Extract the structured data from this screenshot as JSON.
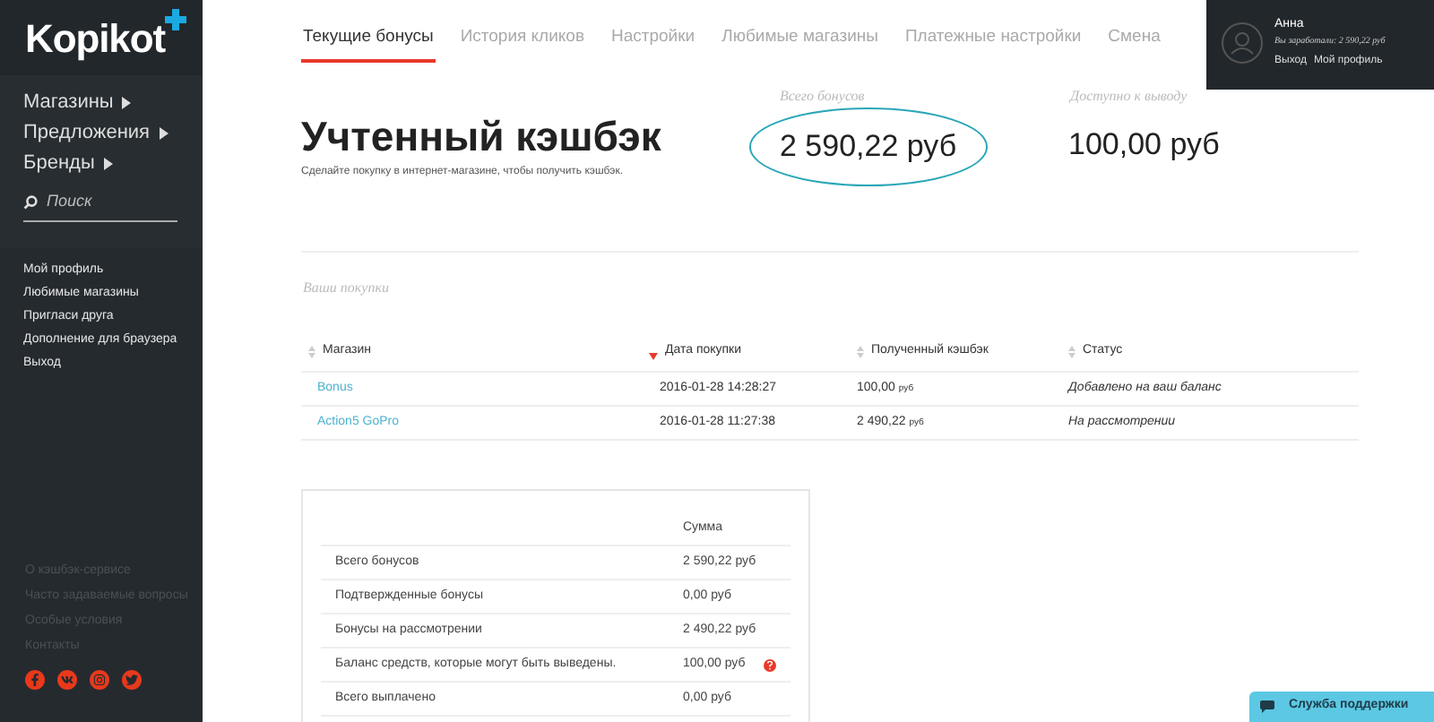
{
  "sidebar": {
    "logo": "Kopikot",
    "nav": [
      {
        "label": "Магазины"
      },
      {
        "label": "Предложения"
      },
      {
        "label": "Бренды"
      }
    ],
    "search": {
      "placeholder": "Поиск"
    },
    "links": [
      "Мой профиль",
      "Любимые магазины",
      "Пригласи друга",
      "Дополнение для браузера",
      "Выход"
    ],
    "footer_links": [
      "О кэшбэк-сервисе",
      "Часто задаваемые вопросы",
      "Особые условия",
      "Контакты"
    ],
    "social": [
      {
        "kind": "facebook"
      },
      {
        "kind": "vk"
      },
      {
        "kind": "instagram"
      },
      {
        "kind": "twitter"
      }
    ]
  },
  "tabs": [
    {
      "label": "Текущие бонусы",
      "selected": true
    },
    {
      "label": "История кликов",
      "selected": false
    },
    {
      "label": "Настройки",
      "selected": false
    },
    {
      "label": "Любимые магазины",
      "selected": false
    },
    {
      "label": "Платежные настройки",
      "selected": false
    },
    {
      "label": "Смена",
      "selected": false
    }
  ],
  "user": {
    "name": "Анна",
    "earned": "Вы заработали: 2 590,22 руб",
    "links": [
      "Выход",
      "Мой профиль"
    ]
  },
  "header": {
    "title": "Учтенный кэшбэк",
    "subtitle": "Сделайте покупку в интернет-магазине, чтобы получить кэшбэк.",
    "stats": [
      {
        "label": "Всего бонусов",
        "value": "2 590,22 руб",
        "circled": true
      },
      {
        "label": "Доступно к выводу",
        "value": "100,00 руб",
        "circled": false
      }
    ]
  },
  "purchases": {
    "title": "Ваши покупки",
    "columns": [
      {
        "label": "Магазин",
        "sorted": false
      },
      {
        "label": "Дата покупки",
        "sorted": true
      },
      {
        "label": "Полученный кэшбэк",
        "sorted": false
      },
      {
        "label": "Статус",
        "sorted": false
      }
    ],
    "rows": [
      {
        "store": "Bonus",
        "date": "2016-01-28 14:28:27",
        "amount": "100,00",
        "currency": "руб",
        "status": "Добавлено на ваш баланс"
      },
      {
        "store": "Action5 GoPro",
        "date": "2016-01-28 11:27:38",
        "amount": "2 490,22",
        "currency": "руб",
        "status": "На рассмотрении"
      }
    ]
  },
  "summary": {
    "column": "Сумма",
    "rows": [
      {
        "label": "Всего бонусов",
        "value": "2 590,22 руб",
        "help": false
      },
      {
        "label": "Подтвержденные бонусы",
        "value": "0,00 руб",
        "help": false
      },
      {
        "label": "Бонусы на рассмотрении",
        "value": "2 490,22 руб",
        "help": false
      },
      {
        "label": "Баланс средств, которые могут быть выведены.",
        "value": "100,00 руб",
        "help": true
      },
      {
        "label": "Всего выплачено",
        "value": "0,00 руб",
        "help": false
      }
    ]
  },
  "support": {
    "label": "Служба поддержки"
  }
}
